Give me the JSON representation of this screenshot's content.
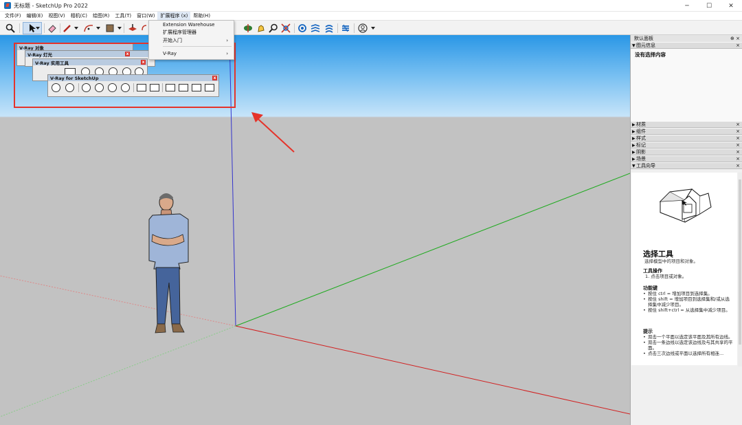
{
  "window": {
    "title": "无标题 - SketchUp Pro 2022",
    "minimize": "─",
    "maximize": "☐",
    "close": "✕"
  },
  "menu": [
    "文件(F)",
    "编辑(E)",
    "视图(V)",
    "相机(C)",
    "绘图(R)",
    "工具(T)",
    "窗口(W)",
    "扩展程序 (x)",
    "帮助(H)"
  ],
  "extensions_menu": {
    "items": [
      "Extension Warehouse",
      "扩展程序管理器",
      "开始入门",
      "V-Ray"
    ]
  },
  "toolbars": {
    "vray_objects": "V-Ray 对象",
    "vray_lights": "V-Ray 灯光",
    "vray_utilities": "V-Ray 实用工具",
    "vray_main": "V-Ray for SketchUp",
    "close_glyph": "x"
  },
  "default_tray": {
    "title": "默认面板",
    "entity_info": {
      "header": "图元信息",
      "status": "没有选择内容"
    },
    "collapsed_trays": [
      "材质",
      "组件",
      "样式",
      "标记",
      "阴影",
      "场景"
    ],
    "instructor": {
      "header": "工具向导",
      "tool_name": "选择工具",
      "tool_desc": "选择模型中的项目和对象。",
      "ops_heading": "工具操作",
      "ops_items": [
        "1. 点击项目或对象。"
      ],
      "keys_heading": "功能键",
      "keys_items": [
        "按住 ctrl = 增加项目到选择集。",
        "按住 shift = 增加项目到选择集和/或从选择集中减少项目。",
        "按住 shift+ctrl = 从选择集中减少项目。"
      ],
      "tips_heading": "提示",
      "tips_items": [
        "双击一个平面以选定该平面及其所有边线。",
        "双击一条边线以选定该边线及与其共享的平面。",
        "点击三次边线或平面以选择所有相连..."
      ]
    }
  },
  "colors": {
    "highlight_box": "#e5332a",
    "sky_top": "#2a97e6",
    "ground": "#c2c2c2"
  }
}
